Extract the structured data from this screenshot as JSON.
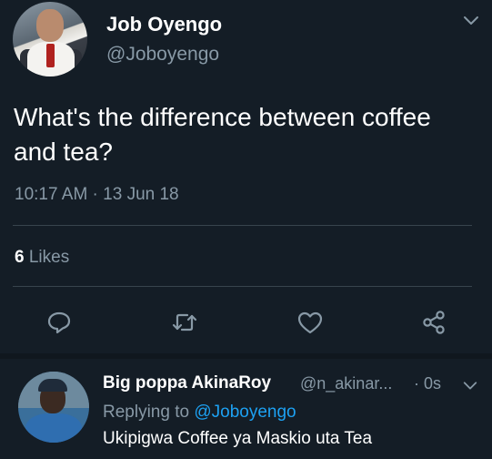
{
  "tweet": {
    "author_name": "Job Oyengo",
    "author_handle": "@Joboyengo",
    "text": "What's the difference between coffee and tea?",
    "timestamp": "10:17 AM · 13 Jun 18",
    "likes_count": "6",
    "likes_label": "Likes",
    "actions": [
      "reply-icon",
      "retweet-icon",
      "like-icon",
      "share-icon"
    ]
  },
  "reply": {
    "author_name": "Big poppa AkinaRoy",
    "author_handle": "@n_akinar...",
    "time": "· 0s",
    "replying_prefix": "Replying to",
    "replying_mention": "@Joboyengo",
    "text": "Ukipigwa Coffee ya Maskio uta Tea"
  },
  "colors": {
    "background": "#141d26",
    "secondary_text": "#8899a6",
    "link": "#1da1f2"
  }
}
